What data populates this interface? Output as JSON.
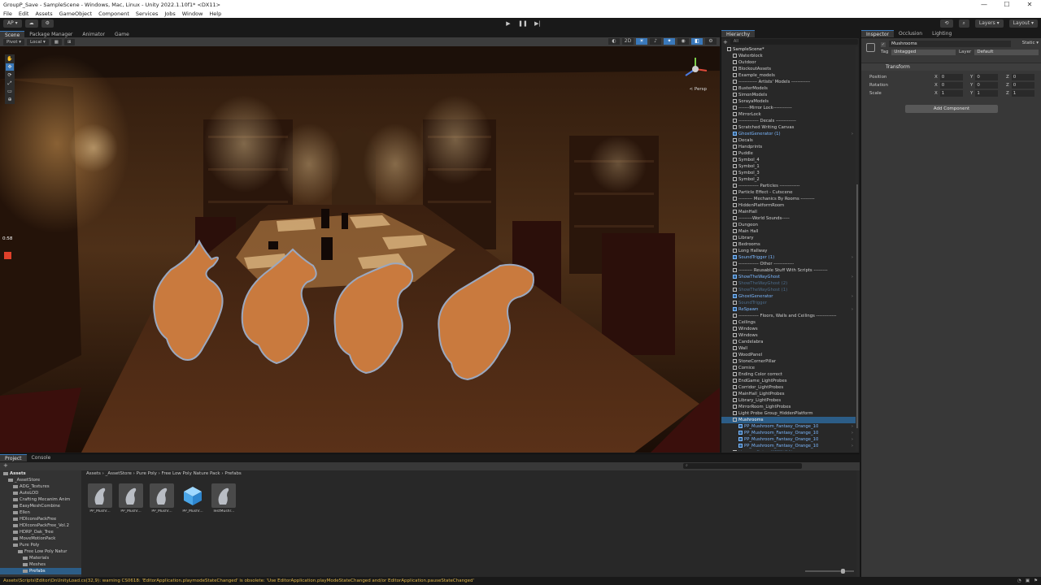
{
  "window": {
    "title": "GroupP_Save - SampleScene - Windows, Mac, Linux - Unity 2022.1.10f1* <DX11>",
    "min": "—",
    "max": "☐",
    "close": "✕"
  },
  "menu": [
    "File",
    "Edit",
    "Assets",
    "GameObject",
    "Component",
    "Services",
    "Jobs",
    "Window",
    "Help"
  ],
  "toolbar": {
    "account": "AP ▾",
    "play": "▶",
    "pause": "❚❚",
    "step": "▶|",
    "layers": "Layers ▾",
    "layout": "Layout ▾"
  },
  "scene_tabs": [
    "Scene",
    "Package Manager",
    "Animator",
    "Game"
  ],
  "scene_toolbar": {
    "pivot": "Pivot ▾",
    "local": "Local ▾",
    "persp": "< Persp"
  },
  "overlay": {
    "time": "0:58"
  },
  "hierarchy": {
    "tab": "Hierarchy",
    "search_placeholder": "All",
    "items": [
      {
        "label": "SampleScene*",
        "kind": "scene",
        "indent": 1
      },
      {
        "label": "Waterblock",
        "kind": "go",
        "indent": 2
      },
      {
        "label": "Outdoor",
        "kind": "go",
        "indent": 2
      },
      {
        "label": "BlockoutAssets",
        "kind": "go",
        "indent": 2
      },
      {
        "label": "Example_models",
        "kind": "go",
        "indent": 2
      },
      {
        "label": "------------ Artists' Models ------------",
        "kind": "go",
        "indent": 2
      },
      {
        "label": "BusterModels",
        "kind": "go",
        "indent": 2
      },
      {
        "label": "SimonModels",
        "kind": "go",
        "indent": 2
      },
      {
        "label": "SorayaModels",
        "kind": "go",
        "indent": 2
      },
      {
        "label": "-------Mirror Lock------------",
        "kind": "go",
        "indent": 2
      },
      {
        "label": "MirrorLock",
        "kind": "go",
        "indent": 2
      },
      {
        "label": "------------- Decals -------------",
        "kind": "go",
        "indent": 2
      },
      {
        "label": "Scratched Writing Canvas",
        "kind": "go",
        "indent": 2
      },
      {
        "label": "GhostGenerator (1)",
        "kind": "prefab",
        "indent": 2
      },
      {
        "label": "Decals",
        "kind": "go",
        "indent": 2
      },
      {
        "label": "Handprints",
        "kind": "go",
        "indent": 2
      },
      {
        "label": "Puddle",
        "kind": "go",
        "indent": 2
      },
      {
        "label": "Symbol_4",
        "kind": "go",
        "indent": 2
      },
      {
        "label": "Symbol_1",
        "kind": "go",
        "indent": 2
      },
      {
        "label": "Symbol_3",
        "kind": "go",
        "indent": 2
      },
      {
        "label": "Symbol_2",
        "kind": "go",
        "indent": 2
      },
      {
        "label": "------------- Particles -------------",
        "kind": "go",
        "indent": 2
      },
      {
        "label": "Particle Effect - Cutscene",
        "kind": "go",
        "indent": 2
      },
      {
        "label": "--------- Mechanics By Rooms ---------",
        "kind": "go",
        "indent": 2
      },
      {
        "label": "HiddenPlatformRoom",
        "kind": "go",
        "indent": 2
      },
      {
        "label": "MainHall",
        "kind": "go",
        "indent": 2
      },
      {
        "label": "---------World Sounds-----",
        "kind": "go",
        "indent": 2
      },
      {
        "label": "Dungeon",
        "kind": "go",
        "indent": 2
      },
      {
        "label": "Main Hall",
        "kind": "go",
        "indent": 2
      },
      {
        "label": "Library",
        "kind": "go",
        "indent": 2
      },
      {
        "label": "Bedrooms",
        "kind": "go",
        "indent": 2
      },
      {
        "label": "Long Hallway",
        "kind": "go",
        "indent": 2
      },
      {
        "label": "SoundTrigger (1)",
        "kind": "prefab",
        "indent": 2
      },
      {
        "label": "------------- Other -------------",
        "kind": "go",
        "indent": 2
      },
      {
        "label": "--------- Reusable Stuff With Scripts ---------",
        "kind": "go",
        "indent": 2
      },
      {
        "label": "ShowTheWayGhost",
        "kind": "prefab",
        "indent": 2
      },
      {
        "label": "ShowTheWayGhost (2)",
        "kind": "dim",
        "indent": 2
      },
      {
        "label": "ShowTheWayGhost (1)",
        "kind": "dim",
        "indent": 2
      },
      {
        "label": "GhostGenerator",
        "kind": "prefab",
        "indent": 2
      },
      {
        "label": "SoundTrigger",
        "kind": "dim",
        "indent": 2
      },
      {
        "label": "ReSpawn",
        "kind": "prefab",
        "indent": 2
      },
      {
        "label": "------------- Floors, Walls and Ceilings -------------",
        "kind": "go",
        "indent": 2
      },
      {
        "label": "Ceilings",
        "kind": "go",
        "indent": 2
      },
      {
        "label": "Windows",
        "kind": "go",
        "indent": 2
      },
      {
        "label": "Windows",
        "kind": "go",
        "indent": 2
      },
      {
        "label": "Candelabra",
        "kind": "go",
        "indent": 2
      },
      {
        "label": "Wall",
        "kind": "go",
        "indent": 2
      },
      {
        "label": "WoodPanel",
        "kind": "go",
        "indent": 2
      },
      {
        "label": "StoneCornerPillar",
        "kind": "go",
        "indent": 2
      },
      {
        "label": "Cornice",
        "kind": "go",
        "indent": 2
      },
      {
        "label": "Ending Color correct",
        "kind": "go",
        "indent": 2
      },
      {
        "label": "EndGame_LightProbes",
        "kind": "go",
        "indent": 2
      },
      {
        "label": "Corridor_LightProbes",
        "kind": "go",
        "indent": 2
      },
      {
        "label": "MainHall_LightProbes",
        "kind": "go",
        "indent": 2
      },
      {
        "label": "Library_LightProbes",
        "kind": "go",
        "indent": 2
      },
      {
        "label": "MirrorRoom_LightProbes",
        "kind": "go",
        "indent": 2
      },
      {
        "label": "Light Probe Group_HiddenPlatform",
        "kind": "go",
        "indent": 2
      },
      {
        "label": "Mushrooms",
        "kind": "selected",
        "indent": 2
      },
      {
        "label": "PP_Mushroom_Fantasy_Orange_10",
        "kind": "prefab",
        "indent": 3
      },
      {
        "label": "PP_Mushroom_Fantasy_Orange_10",
        "kind": "prefab",
        "indent": 3
      },
      {
        "label": "PP_Mushroom_Fantasy_Orange_10",
        "kind": "prefab",
        "indent": 3
      },
      {
        "label": "PP_Mushroom_Fantasy_Orange_10",
        "kind": "prefab",
        "indent": 3
      },
      {
        "label": "HumanoBeing (KPP1V11)",
        "kind": "dim",
        "indent": 2
      }
    ]
  },
  "inspector": {
    "tabs": [
      "Inspector",
      "Occlusion",
      "Lighting"
    ],
    "object_name": "Mushrooms",
    "static_label": "Static ▾",
    "tag_label": "Tag",
    "tag_value": "Untagged",
    "layer_label": "Layer",
    "layer_value": "Default",
    "component": "Transform",
    "position_label": "Position",
    "rotation_label": "Rotation",
    "scale_label": "Scale",
    "axis": [
      "X",
      "Y",
      "Z"
    ],
    "position": [
      "0",
      "0",
      "0"
    ],
    "rotation": [
      "0",
      "0",
      "0"
    ],
    "scale": [
      "1",
      "1",
      "1"
    ],
    "add_component": "Add Component"
  },
  "project": {
    "tabs": [
      "Project",
      "Console"
    ],
    "tree": [
      {
        "label": "Assets",
        "indent": 0,
        "style": "bold"
      },
      {
        "label": "_AssetStore",
        "indent": 1
      },
      {
        "label": "ADG_Textures",
        "indent": 2
      },
      {
        "label": "AutoLOD",
        "indent": 2
      },
      {
        "label": "Crafting Mecanim Anim",
        "indent": 2
      },
      {
        "label": "EasyMeshCombine",
        "indent": 2
      },
      {
        "label": "Ellen",
        "indent": 2
      },
      {
        "label": "HDIconsPackFree",
        "indent": 2
      },
      {
        "label": "HDIconsPackFree_Vol.2",
        "indent": 2
      },
      {
        "label": "HDRP_Oak_Tree",
        "indent": 2
      },
      {
        "label": "MoveMotionPack",
        "indent": 2
      },
      {
        "label": "Pure Poly",
        "indent": 2
      },
      {
        "label": "Free Low Poly Natur",
        "indent": 3
      },
      {
        "label": "Materials",
        "indent": 4
      },
      {
        "label": "Meshes",
        "indent": 4
      },
      {
        "label": "Prefabs",
        "indent": 4,
        "style": "sel"
      }
    ],
    "breadcrumb": "Assets › _AssetStore › Pure Poly › Free Low Poly Nature Pack › Prefabs",
    "assets": [
      {
        "label": "PP_Mushr...",
        "icon": "mushroom-thumb"
      },
      {
        "label": "PP_Mushr...",
        "icon": "mushroom-thumb"
      },
      {
        "label": "PP_Mushr...",
        "icon": "mushroom-thumb"
      },
      {
        "label": "PP_Mushr...",
        "icon": "prefab-cube"
      },
      {
        "label": "TestMushr...",
        "icon": "mushroom-thumb"
      }
    ]
  },
  "status": "Assets\\Scripts\\Editor\\OnUnityLoad.cs(32,9): warning CS0618: 'EditorApplication.playmodeStateChanged' is obsolete: 'Use EditorApplication.playModeStateChanged and/or EditorApplication.pauseStateChanged'"
}
